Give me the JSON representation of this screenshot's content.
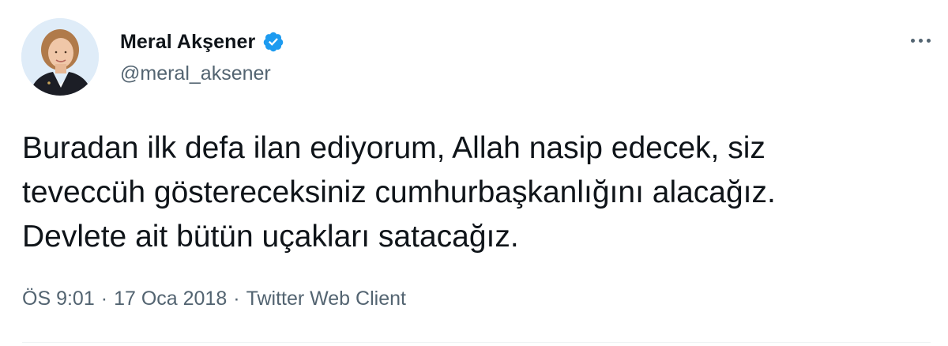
{
  "author": {
    "display_name": "Meral Akşener",
    "handle": "@meral_aksener",
    "verified": true
  },
  "tweet": {
    "lines": [
      "Buradan ilk defa ilan ediyorum, Allah nasip edecek, siz",
      "teveccüh göstereceksiniz cumhurbaşkanlığını alacağız.",
      "Devlete ait bütün uçakları satacağız."
    ]
  },
  "meta": {
    "time": "ÖS 9:01",
    "separator": "·",
    "date": "17 Oca 2018",
    "client": "Twitter Web Client"
  },
  "colors": {
    "text": "#0f1419",
    "secondary": "#536471",
    "verified": "#1d9bf0"
  },
  "icons": {
    "more": "more-horizontal-icon",
    "verified": "verified-badge-icon"
  }
}
